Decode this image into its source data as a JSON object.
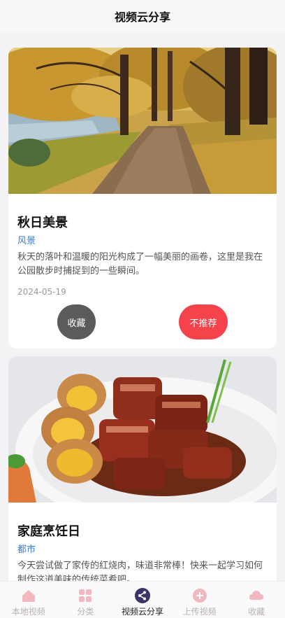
{
  "header": {
    "title": "视频云分享"
  },
  "posts": [
    {
      "title": "秋日美景",
      "category": "风景",
      "description": "秋天的落叶和温暖的阳光构成了一幅美丽的画卷，这里是我在公园散步时捕捉到的一些瞬间。",
      "date": "2024-05-19",
      "favorite_label": "收藏",
      "dislike_label": "不推荐",
      "image_icon": "autumn-park-path-image"
    },
    {
      "title": "家庭烹饪日",
      "category": "都市",
      "description": "今天尝试做了家传的红烧肉，味道非常棒！快来一起学习如何制作这道美味的传统菜肴吧。",
      "image_icon": "braised-pork-dish-image"
    }
  ],
  "tabbar": {
    "items": [
      {
        "label": "本地视频",
        "icon": "home-icon"
      },
      {
        "label": "分类",
        "icon": "grid-icon"
      },
      {
        "label": "视频云分享",
        "icon": "share-icon",
        "active": true
      },
      {
        "label": "上传视频",
        "icon": "upload-plus-icon"
      },
      {
        "label": "收藏",
        "icon": "cloud-icon"
      }
    ]
  },
  "colors": {
    "accent_blue": "#3a7bd5",
    "dislike_red": "#f5434c",
    "favorite_gray": "#5b5b5b",
    "active_tab": "#3d3569",
    "inactive_tab": "#f2b8c0"
  }
}
